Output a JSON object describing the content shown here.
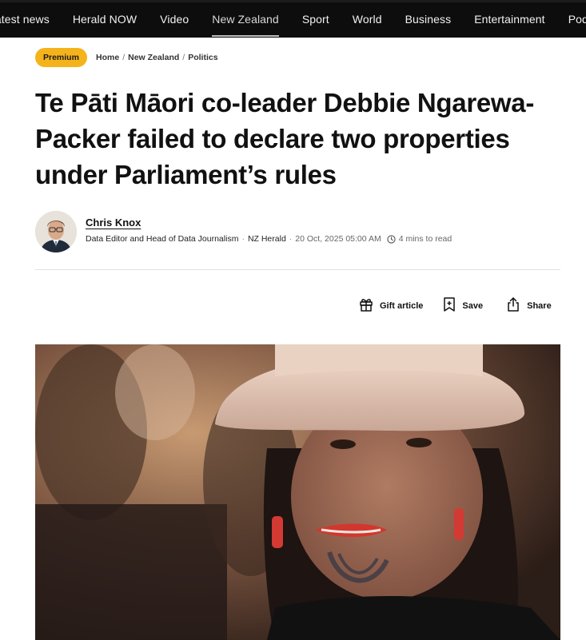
{
  "nav": {
    "items": [
      {
        "label": "Latest news",
        "active": false
      },
      {
        "label": "Herald NOW",
        "active": false
      },
      {
        "label": "Video",
        "active": false
      },
      {
        "label": "New Zealand",
        "active": true
      },
      {
        "label": "Sport",
        "active": false
      },
      {
        "label": "World",
        "active": false
      },
      {
        "label": "Business",
        "active": false
      },
      {
        "label": "Entertainment",
        "active": false
      },
      {
        "label": "Podcasts",
        "active": false
      }
    ]
  },
  "badge": {
    "label": "Premium"
  },
  "breadcrumb": {
    "home": "Home",
    "section": "New Zealand",
    "subsection": "Politics",
    "separator": "/"
  },
  "article": {
    "headline": "Te Pāti Māori co-leader Debbie Ngarewa-Packer failed to declare two properties under Parliament’s rules",
    "author": {
      "name": "Chris Knox",
      "role": "Data Editor and Head of Data Journalism",
      "outlet": "NZ Herald",
      "date": "20 Oct, 2025 05:00 AM",
      "read_time": "4 mins to read"
    },
    "separator": "·"
  },
  "actions": {
    "gift": {
      "label": "Gift article",
      "icon": "gift-icon"
    },
    "save": {
      "label": "Save",
      "icon": "bookmark-plus-icon"
    },
    "share": {
      "label": "Share",
      "icon": "share-icon"
    }
  },
  "colors": {
    "nav_bg": "#0d0d0d",
    "premium_badge": "#f5b31b"
  }
}
